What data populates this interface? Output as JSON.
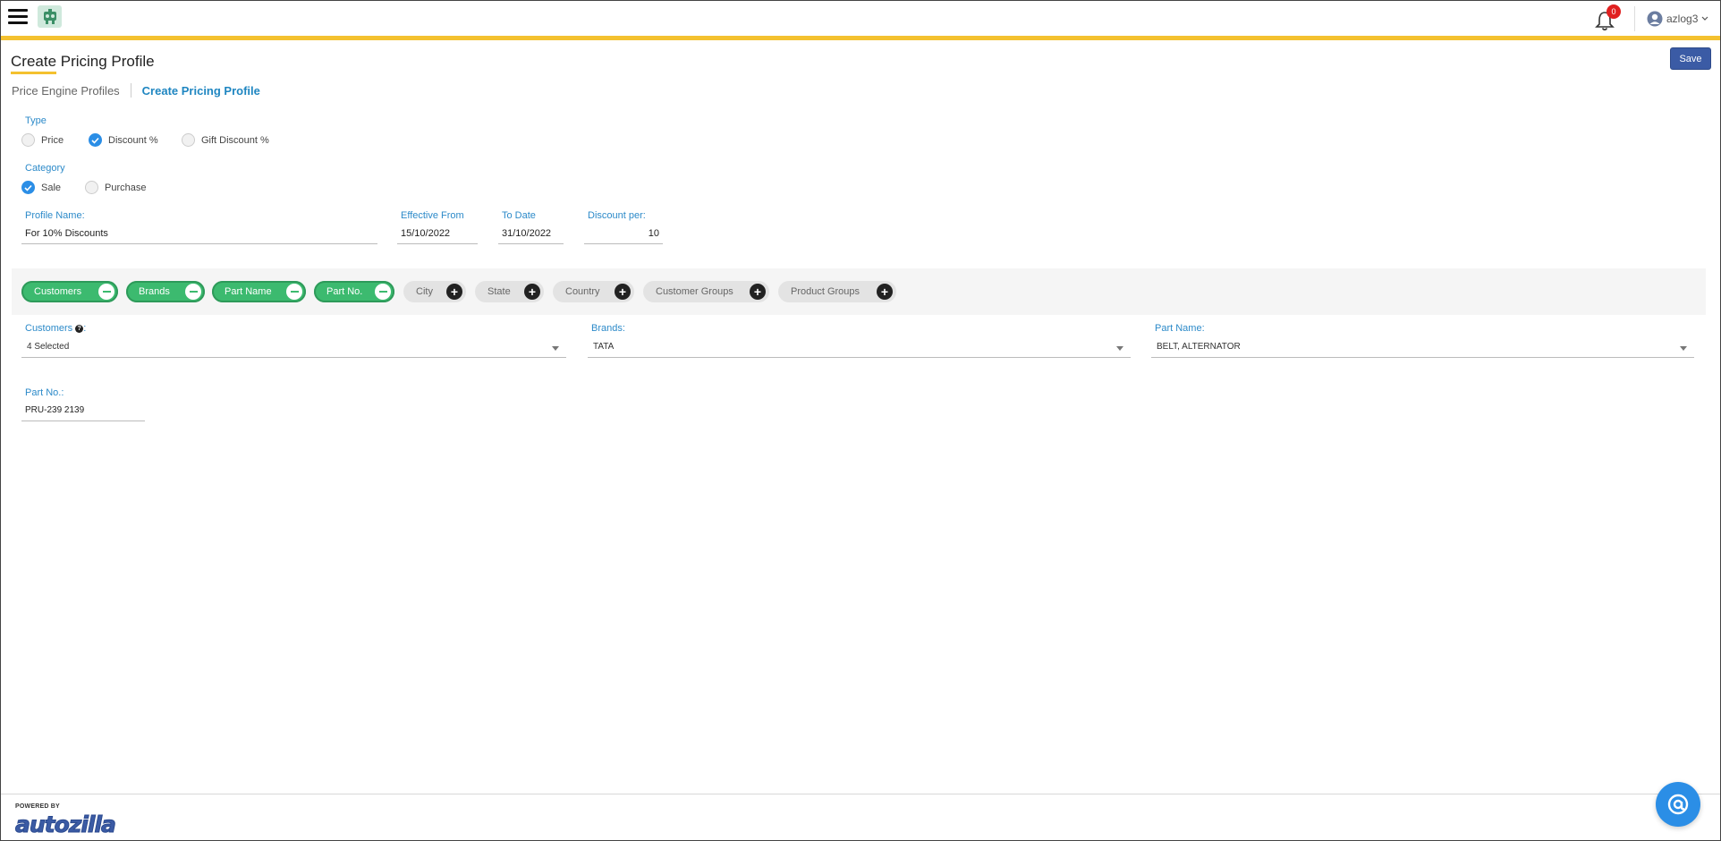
{
  "header": {
    "notification_count": "0",
    "username": "azlog3",
    "accent_color": "#f4c12f"
  },
  "page": {
    "title": "Create Pricing Profile",
    "save_label": "Save",
    "breadcrumb": [
      "Price Engine Profiles",
      "Create Pricing Profile"
    ]
  },
  "type": {
    "label": "Type",
    "options": [
      {
        "label": "Price",
        "checked": false
      },
      {
        "label": "Discount %",
        "checked": true
      },
      {
        "label": "Gift Discount %",
        "checked": false
      }
    ]
  },
  "category": {
    "label": "Category",
    "options": [
      {
        "label": "Sale",
        "checked": true
      },
      {
        "label": "Purchase",
        "checked": false
      }
    ]
  },
  "fields": {
    "profile_name": {
      "label": "Profile Name:",
      "value": "For 10% Discounts"
    },
    "effective_from": {
      "label": "Effective From",
      "value": "15/10/2022"
    },
    "to_date": {
      "label": "To Date",
      "value": "31/10/2022"
    },
    "discount_per": {
      "label": "Discount per:",
      "value": "10"
    }
  },
  "chips": [
    {
      "label": "Customers",
      "active": true
    },
    {
      "label": "Brands",
      "active": true
    },
    {
      "label": "Part Name",
      "active": true
    },
    {
      "label": "Part No.",
      "active": true
    },
    {
      "label": "City",
      "active": false
    },
    {
      "label": "State",
      "active": false
    },
    {
      "label": "Country",
      "active": false
    },
    {
      "label": "Customer Groups",
      "active": false
    },
    {
      "label": "Product Groups",
      "active": false
    }
  ],
  "filters": {
    "customers": {
      "label": "Customers",
      "value": "4 Selected"
    },
    "brands": {
      "label": "Brands:",
      "value": "TATA"
    },
    "part_name": {
      "label": "Part Name:",
      "value": "BELT, ALTERNATOR"
    },
    "part_no": {
      "label": "Part No.:",
      "value": "PRU-239 2139"
    }
  },
  "footer": {
    "powered_by": "POWERED BY",
    "brand": "autozilla"
  }
}
